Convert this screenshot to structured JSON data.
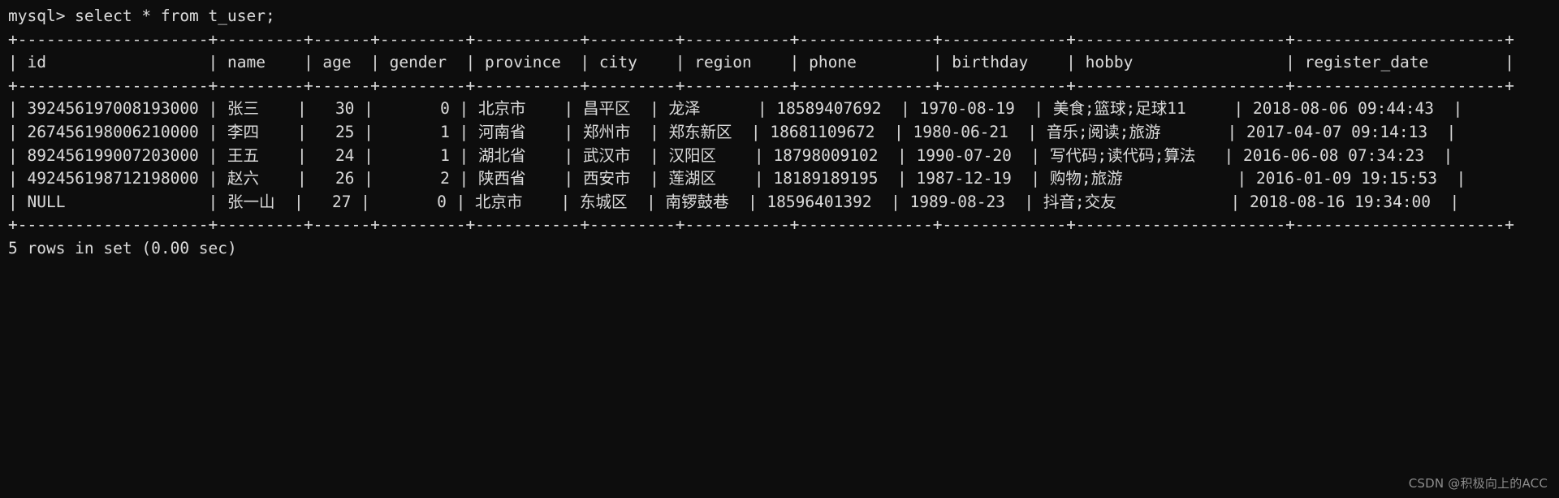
{
  "terminal": {
    "prompt": "mysql> ",
    "command": "select * from t_user;",
    "background_color": "#0d0d0d",
    "text_color": "#d8d8d8",
    "footer": "5 rows in set (0.00 sec)",
    "watermark": "CSDN @积极向上的ACC"
  },
  "result_table": {
    "columns": [
      {
        "name": "id",
        "width": 18,
        "align": "left"
      },
      {
        "name": "name",
        "width": 7,
        "align": "left"
      },
      {
        "name": "age",
        "width": 4,
        "align": "right"
      },
      {
        "name": "gender",
        "width": 7,
        "align": "right"
      },
      {
        "name": "province",
        "width": 9,
        "align": "left"
      },
      {
        "name": "city",
        "width": 7,
        "align": "left"
      },
      {
        "name": "region",
        "width": 9,
        "align": "left"
      },
      {
        "name": "phone",
        "width": 12,
        "align": "left"
      },
      {
        "name": "birthday",
        "width": 11,
        "align": "left"
      },
      {
        "name": "hobby",
        "width": 20,
        "align": "left"
      },
      {
        "name": "register_date",
        "width": 20,
        "align": "left"
      }
    ],
    "rows": [
      {
        "id": "392456197008193000",
        "name": "张三",
        "age": "30",
        "gender": "0",
        "province": "北京市",
        "city": "昌平区",
        "region": "龙泽",
        "phone": "18589407692",
        "birthday": "1970-08-19",
        "hobby": "美食;篮球;足球11",
        "register_date": "2018-08-06 09:44:43"
      },
      {
        "id": "267456198006210000",
        "name": "李四",
        "age": "25",
        "gender": "1",
        "province": "河南省",
        "city": "郑州市",
        "region": "郑东新区",
        "phone": "18681109672",
        "birthday": "1980-06-21",
        "hobby": "音乐;阅读;旅游",
        "register_date": "2017-04-07 09:14:13"
      },
      {
        "id": "892456199007203000",
        "name": "王五",
        "age": "24",
        "gender": "1",
        "province": "湖北省",
        "city": "武汉市",
        "region": "汉阳区",
        "phone": "18798009102",
        "birthday": "1990-07-20",
        "hobby": "写代码;读代码;算法",
        "register_date": "2016-06-08 07:34:23"
      },
      {
        "id": "492456198712198000",
        "name": "赵六",
        "age": "26",
        "gender": "2",
        "province": "陕西省",
        "city": "西安市",
        "region": "莲湖区",
        "phone": "18189189195",
        "birthday": "1987-12-19",
        "hobby": "购物;旅游",
        "register_date": "2016-01-09 19:15:53"
      },
      {
        "id": "NULL",
        "name": "张一山",
        "age": "27",
        "gender": "0",
        "province": "北京市",
        "city": "东城区",
        "region": "南锣鼓巷",
        "phone": "18596401392",
        "birthday": "1989-08-23",
        "hobby": "抖音;交友",
        "register_date": "2018-08-16 19:34:00"
      }
    ]
  }
}
